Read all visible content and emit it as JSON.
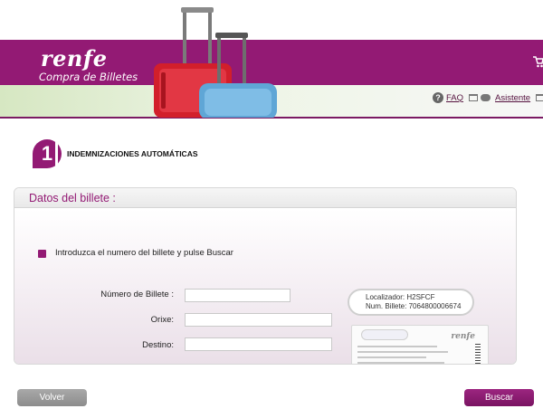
{
  "header": {
    "logo": "renfe",
    "tagline": "Compra de Billetes",
    "nav": {
      "faq": "FAQ",
      "assistant": "Asistente"
    }
  },
  "step": {
    "number": "1",
    "title": "INDEMNIZACIONES AUTOMÁTICAS"
  },
  "panel": {
    "title": "Datos del billete :",
    "instruction": "Introduzca el numero del billete y pulse Buscar",
    "fields": {
      "ticket_number": {
        "label": "Número de Billete :",
        "value": ""
      },
      "origin": {
        "label": "Orixe:",
        "value": ""
      },
      "destination": {
        "label": "Destino:",
        "value": ""
      }
    },
    "ticket_help": {
      "localizador": "Localizador: H2SFCF",
      "num_billete": "Num. Billete: 7064800006674",
      "ticket_brand": "renfe"
    }
  },
  "buttons": {
    "back": "Volver",
    "search": "Buscar"
  },
  "colors": {
    "accent": "#931a74",
    "button_gray": "#9a9a9a"
  }
}
